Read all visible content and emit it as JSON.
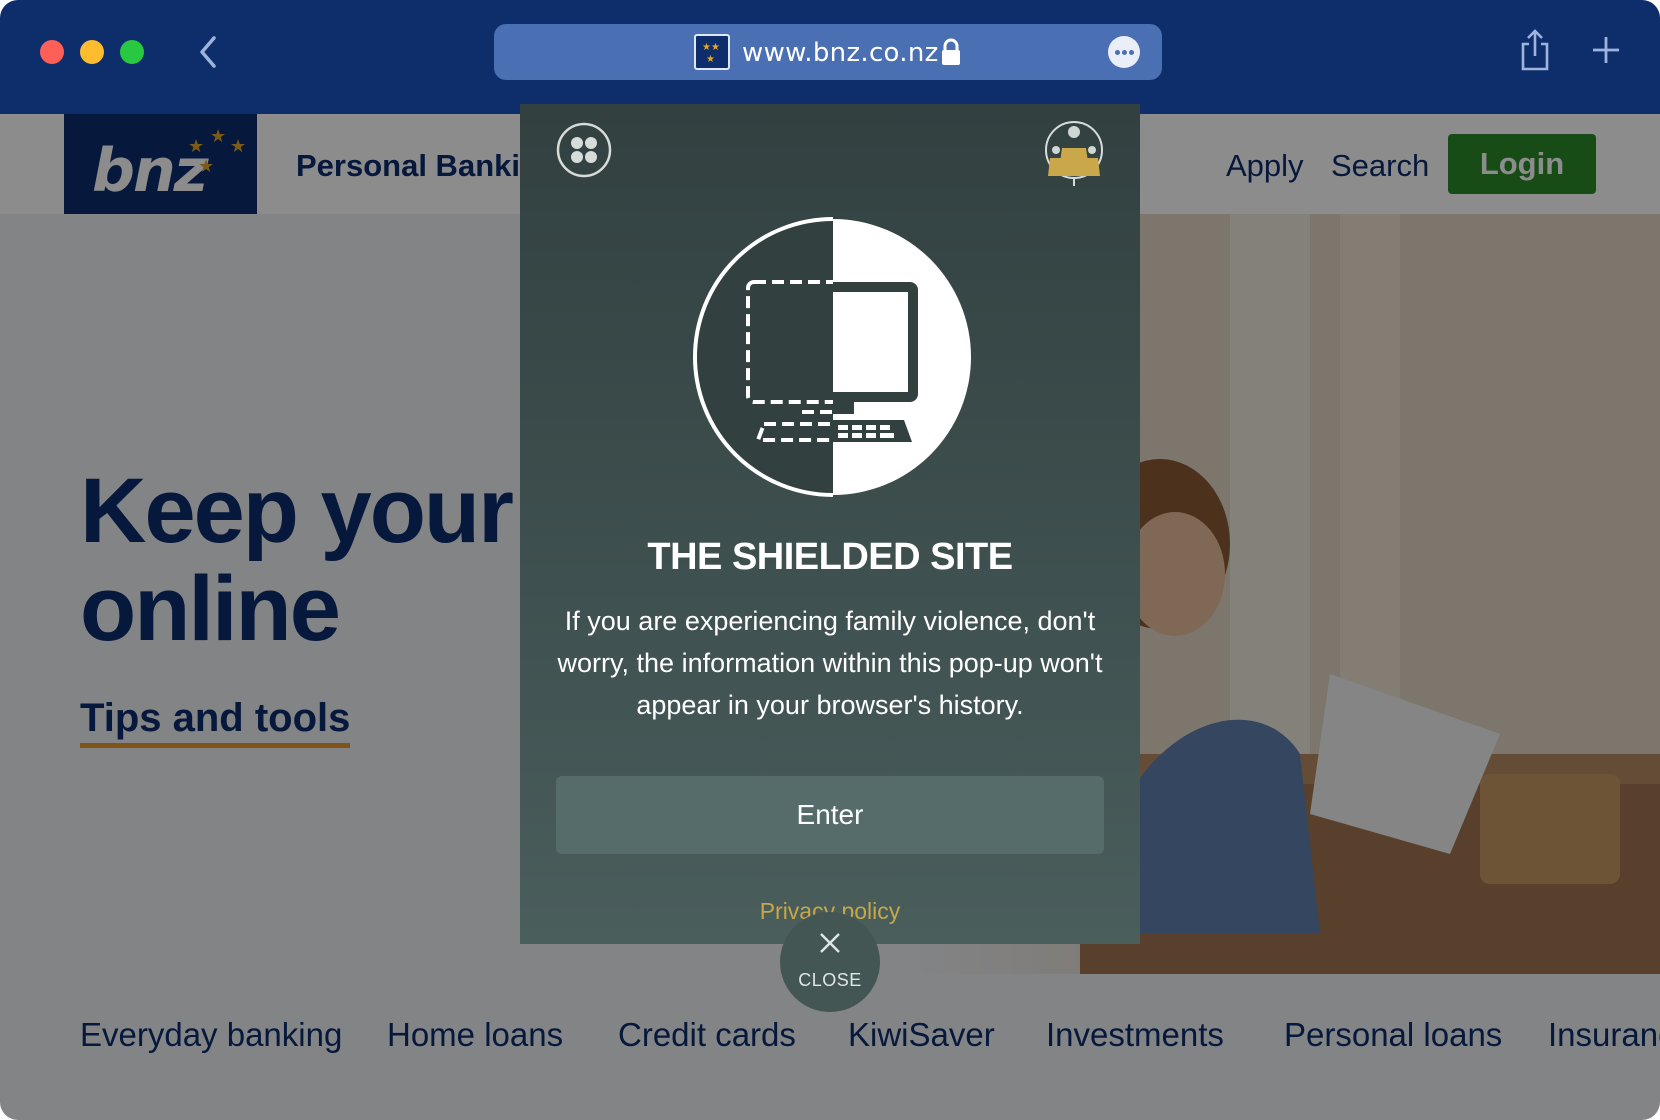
{
  "browser": {
    "url": "www.bnz.co.nz"
  },
  "header": {
    "logo_text": "bnz",
    "nav_personal": "Personal Banki",
    "nav_apply": "Apply",
    "nav_search": "Search",
    "login_label": "Login"
  },
  "hero": {
    "title_line1": "Keep your",
    "title_line2": "online",
    "link_label": "Tips and tools"
  },
  "bottom_nav": {
    "items": [
      {
        "label": "Everyday banking"
      },
      {
        "label": "Home loans"
      },
      {
        "label": "Credit cards"
      },
      {
        "label": "KiwiSaver"
      },
      {
        "label": "Investments"
      },
      {
        "label": "Personal loans"
      },
      {
        "label": "Insuranc"
      }
    ]
  },
  "modal": {
    "title": "THE SHIELDED SITE",
    "body": "If you are experiencing family violence, don't worry, the information within this pop-up won't appear in your browser's history.",
    "enter_label": "Enter",
    "privacy_label": "Privacy policy",
    "close_label": "CLOSE"
  },
  "colors": {
    "brand_navy": "#0b2d6c",
    "login_green": "#2b8a2a",
    "accent_orange": "#e89a2a",
    "modal_bg": "#3f5150",
    "privacy_gold": "#c8a64a"
  },
  "icons": {
    "back": "chevron-left-icon",
    "lock": "lock-icon",
    "more": "ellipsis-icon",
    "share": "share-icon",
    "new_tab": "plus-icon",
    "menu": "four-dots-icon",
    "brand": "shielded-site-icon",
    "monitor": "monitor-icon",
    "close": "close-icon"
  }
}
